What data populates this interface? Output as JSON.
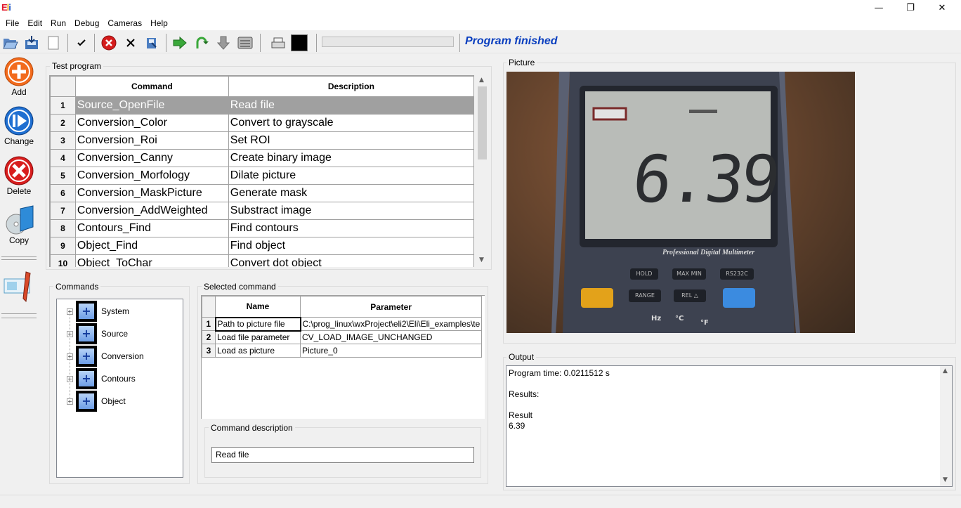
{
  "app": {
    "logo": "Eli"
  },
  "window": {
    "minimize": "—",
    "maximize": "❐",
    "close": "✕"
  },
  "menu": [
    "File",
    "Edit",
    "Run",
    "Debug",
    "Cameras",
    "Help"
  ],
  "toolbar": {
    "status_text": "Program finished",
    "progress": 0
  },
  "left_buttons": {
    "add": "Add",
    "change": "Change",
    "delete": "Delete",
    "copy": "Copy"
  },
  "test_program": {
    "title": "Test program",
    "headers": {
      "command": "Command",
      "description": "Description"
    },
    "rows": [
      {
        "n": "1",
        "command": "Source_OpenFile",
        "description": "Read file"
      },
      {
        "n": "2",
        "command": "Conversion_Color",
        "description": "Convert to grayscale"
      },
      {
        "n": "3",
        "command": "Conversion_Roi",
        "description": "Set ROI"
      },
      {
        "n": "4",
        "command": "Conversion_Canny",
        "description": "Create binary image"
      },
      {
        "n": "5",
        "command": "Conversion_Morfology",
        "description": "Dilate picture"
      },
      {
        "n": "6",
        "command": "Conversion_MaskPicture",
        "description": "Generate mask"
      },
      {
        "n": "7",
        "command": "Conversion_AddWeighted",
        "description": "Substract image"
      },
      {
        "n": "8",
        "command": "Contours_Find",
        "description": "Find contours"
      },
      {
        "n": "9",
        "command": "Object_Find",
        "description": "Find object"
      },
      {
        "n": "10",
        "command": "Object_ToChar",
        "description": "Convert dot object"
      }
    ]
  },
  "commands": {
    "title": "Commands",
    "items": [
      "System",
      "Source",
      "Conversion",
      "Contours",
      "Object"
    ]
  },
  "selected_command": {
    "title": "Selected command",
    "headers": {
      "name": "Name",
      "parameter": "Parameter"
    },
    "rows": [
      {
        "n": "1",
        "name": "Path to picture file",
        "parameter": "C:\\prog_linux\\wxProject\\eli2\\Eli\\Eli_examples\\te"
      },
      {
        "n": "2",
        "name": "Load file parameter",
        "parameter": "CV_LOAD_IMAGE_UNCHANGED"
      },
      {
        "n": "3",
        "name": "Load as picture",
        "parameter": "Picture_0"
      }
    ]
  },
  "command_description": {
    "title": "Command description",
    "value": "Read file"
  },
  "picture": {
    "title": "Picture",
    "display_value": "6.39",
    "brand_text": "Professional Digital Multimeter",
    "buttons": [
      "HOLD",
      "MAX MIN",
      "RS232C",
      "RANGE",
      "REL △",
      "Hz",
      "°C",
      "°F"
    ]
  },
  "output": {
    "title": "Output",
    "lines": [
      "Program time: 0.0211512 s",
      "",
      "Results:",
      "",
      "Result",
      "6.39"
    ]
  },
  "colors": {
    "status": "#0a3fbf",
    "selected_row": "#a0a0a0",
    "add": "#f26b1d",
    "change": "#1f6fd1",
    "delete": "#d81e1e"
  }
}
